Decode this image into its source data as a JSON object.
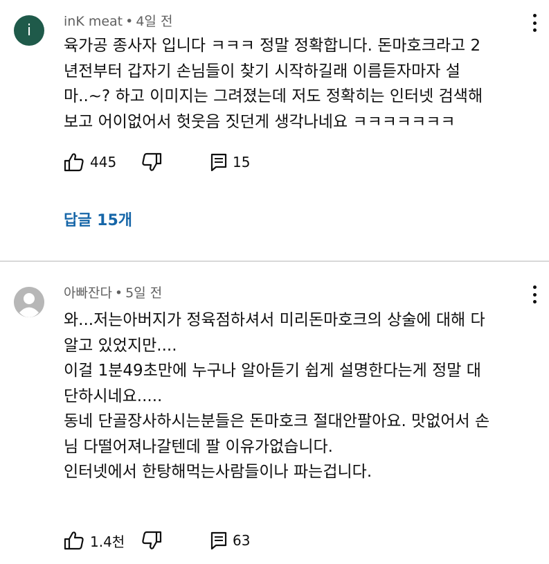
{
  "comments": [
    {
      "author": "inK meat",
      "avatar_letter": "i",
      "time": "4일 전",
      "lines": [
        "육가공 종사자 입니다 ㅋㅋㅋ 정말 정확합니다. 돈마호크라고 2",
        "년전부터 갑자기 손님들이 찾기 시작하길래 이름듣자마자 설",
        "마..~? 하고 이미지는 그려졌는데 저도 정확히는 인터넷 검색해",
        "보고 어이없어서 헛웃음 짓던게 생각나네요 ㅋㅋㅋㅋㅋㅋㅋ"
      ],
      "likes": "445",
      "reply_count": "15",
      "replies_link": "답글 15개"
    },
    {
      "author": "아빠잔다",
      "time": "5일 전",
      "lines": [
        "와...저는아버지가 정육점하셔서 미리돈마호크의 상술에 대해 다",
        "알고 있었지만....",
        "이걸 1분49초만에 누구나 알아듣기 쉽게 설명한다는게 정말 대",
        "단하시네요.....",
        "동네 단골장사하시는분들은 돈마호크 절대안팔아요. 맛없어서 손",
        "님 다떨어져나갈텐데 팔 이유가없습니다.",
        "인터넷에서 한탕해먹는사람들이나 파는겁니다."
      ],
      "likes": "1.4천",
      "reply_count": "63"
    }
  ],
  "separator": "•",
  "icons": {
    "like": "thumbs-up-icon",
    "dislike": "thumbs-down-icon",
    "reply": "reply-comment-icon",
    "more": "more-vert-icon",
    "avatar_default": "person-avatar-icon"
  },
  "colors": {
    "link": "#1666a8",
    "meta": "#606060",
    "avatar_1": "#1f5a4a",
    "avatar_2": "#b7b7b7"
  }
}
